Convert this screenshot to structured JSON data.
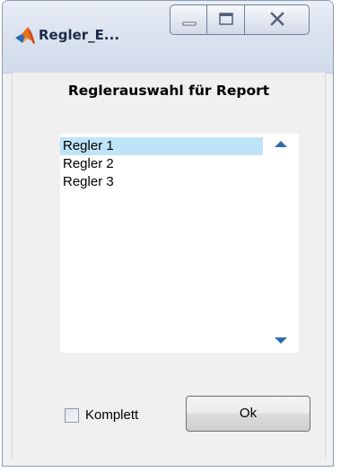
{
  "window": {
    "title": "Regler_E..."
  },
  "dialog": {
    "heading": "Reglerauswahl für Report",
    "list": {
      "items": [
        "Regler 1",
        "Regler 2",
        "Regler 3"
      ],
      "selected_index": 0
    },
    "checkbox": {
      "label": "Komplett",
      "checked": false
    },
    "ok_label": "Ok"
  },
  "colors": {
    "selection": "#bfe4f8",
    "scroll_arrow": "#2f6eab",
    "titlebar": "#dbe3ef"
  },
  "icons": {
    "app": "matlab-logo-icon",
    "minimize": "minimize-icon",
    "maximize": "maximize-icon",
    "close": "close-icon",
    "scroll_up": "triangle-up-icon",
    "scroll_down": "triangle-down-icon"
  }
}
